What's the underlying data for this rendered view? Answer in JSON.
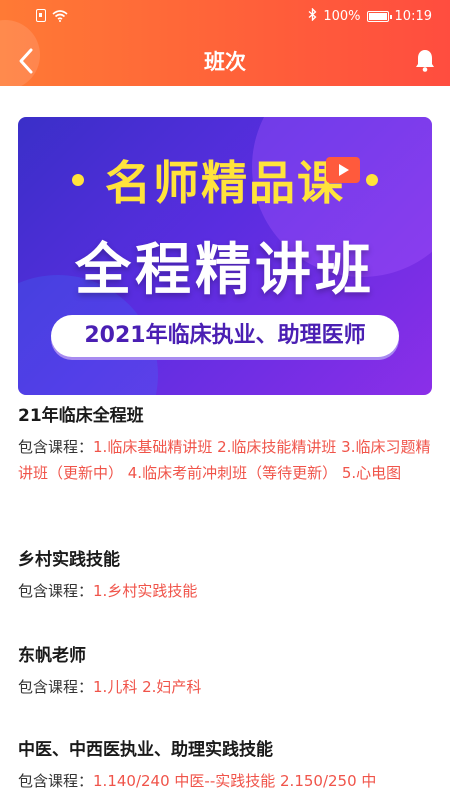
{
  "status_bar": {
    "battery_percent": "100%",
    "time": "10:19"
  },
  "header": {
    "title": "班次"
  },
  "banner": {
    "line1": "名师精品课",
    "line2": "全程精讲班",
    "pill": "2021年临床执业、助理医师"
  },
  "courses": [
    {
      "title": "21年临床全程班",
      "label": "包含课程：",
      "items": "1.临床基础精讲班 2.临床技能精讲班 3.临床习题精讲班（更新中） 4.临床考前冲刺班（等待更新） 5.心电图"
    },
    {
      "title": "乡村实践技能",
      "label": "包含课程：",
      "items": "1.乡村实践技能"
    },
    {
      "title": "东帆老师",
      "label": "包含课程：",
      "items": "1.儿科 2.妇产科"
    },
    {
      "title": "中医、中西医执业、助理实践技能",
      "label": "包含课程：",
      "items": "1.140/240 中医--实践技能 2.150/250 中"
    }
  ],
  "colors": {
    "header_start": "#ff7a35",
    "header_end": "#ff4d3f",
    "accent_text": "#f0544a",
    "banner_yellow": "#ffe33b"
  },
  "icons": {
    "back": "chevron-left-icon",
    "notify": "bell-icon"
  }
}
